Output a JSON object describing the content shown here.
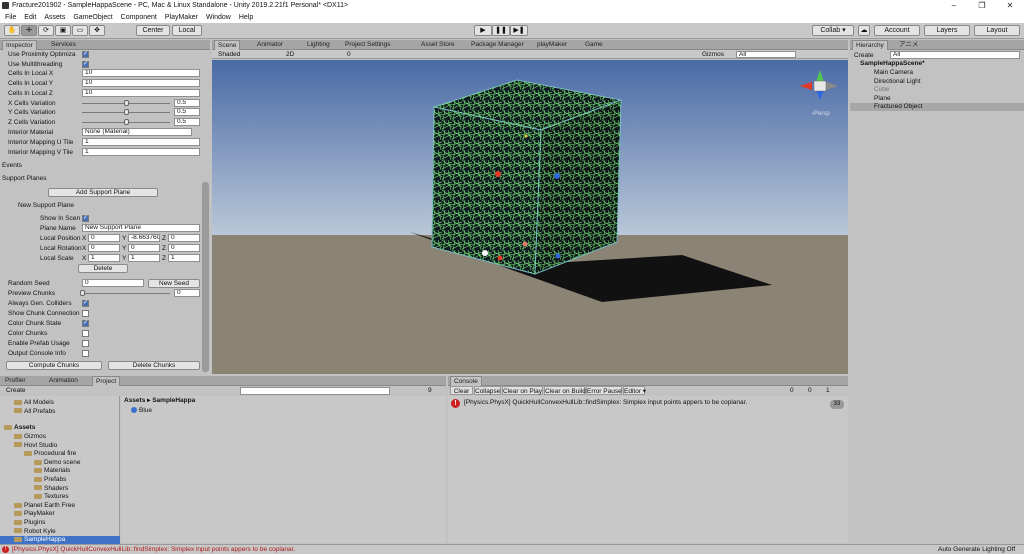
{
  "window": {
    "title": "Fracture201902 - SampleHappaScene - PC, Mac & Linux Standalone - Unity 2019.2.21f1 Personal* <DX11>",
    "minimize": "–",
    "maximize": "❐",
    "close": "✕"
  },
  "menu": [
    "File",
    "Edit",
    "Assets",
    "GameObject",
    "Component",
    "PlayMaker",
    "Window",
    "Help"
  ],
  "toolbar": {
    "center": "Center",
    "local": "Local",
    "collab": "Collab ▾",
    "account": "Account",
    "layers": "Layers",
    "layout": "Layout",
    "play": "▶",
    "pause": "❚❚",
    "step": "▶❚",
    "tools": [
      "✋",
      "✛",
      "⟳",
      "▣",
      "▭",
      "✥"
    ]
  },
  "inspector": {
    "tabs": [
      "Inspector",
      "Services"
    ],
    "rows": [
      {
        "label": "Use Proximity Optimiza",
        "type": "check",
        "on": true
      },
      {
        "label": "Use Multithreading",
        "type": "check",
        "on": true
      },
      {
        "label": "Cells In Local X",
        "type": "field",
        "value": "10"
      },
      {
        "label": "Cells In Local Y",
        "type": "field",
        "value": "10"
      },
      {
        "label": "Cells In Local Z",
        "type": "field",
        "value": "10"
      },
      {
        "label": "X Cells Variation",
        "type": "slider",
        "value": "0.5",
        "level": 0.5
      },
      {
        "label": "Y Cells Variation",
        "type": "slider",
        "value": "0.5",
        "level": 0.5
      },
      {
        "label": "Z Cells Variation",
        "type": "slider",
        "value": "0.5",
        "level": 0.5
      }
    ],
    "interior_material": {
      "label": "Interior Material",
      "value": "None (Material)"
    },
    "mapping_u": {
      "label": "Interior Mapping U Tile",
      "value": "1"
    },
    "mapping_v": {
      "label": "Interior Mapping V Tile",
      "value": "1"
    },
    "events": "Events",
    "support_planes": "Support Planes",
    "add_support_plane": "Add Support Plane",
    "new_support_plane": "New Support Plane",
    "show_in_scene": "Show In Scen",
    "plane_name_label": "Plane Name",
    "plane_name_value": "New Support Plane",
    "local_position": {
      "label": "Local Position",
      "x": "0",
      "y": "-8.663760",
      "z": "0"
    },
    "local_rotation": {
      "label": "Local Rotation",
      "x": "0",
      "y": "0",
      "z": "0"
    },
    "local_scale": {
      "label": "Local Scale",
      "x": "1",
      "y": "1",
      "z": "1"
    },
    "delete": "Delete",
    "random_seed": {
      "label": "Random Seed",
      "value": "0",
      "button": "New Seed"
    },
    "preview_chunks": {
      "label": "Preview Chunks",
      "value": "0",
      "level": 0
    },
    "toggles": [
      {
        "label": "Always Gen. Colliders",
        "on": true
      },
      {
        "label": "Show Chunk Connection",
        "on": false
      },
      {
        "label": "Color Chunk State",
        "on": true
      },
      {
        "label": "Color Chunks",
        "on": false
      },
      {
        "label": "Enable Prefab Usage",
        "on": false
      },
      {
        "label": "Output Console Info",
        "on": false
      }
    ],
    "compute": "Compute Chunks",
    "delete_chunks": "Delete Chunks"
  },
  "scene": {
    "tabs": [
      "Scene",
      "Animator",
      "Lighting",
      "Project Settings",
      "Asset Store",
      "Package Manager",
      "playMaker",
      "Game"
    ],
    "shading": "Shaded",
    "mode2d": "2D",
    "gizmos": "Gizmos",
    "search_placeholder": "All",
    "persp": "‹Persp",
    "counter": "0"
  },
  "hierarchy": {
    "tab": "Hierarchy",
    "tab2": "アニメ",
    "create": "Create",
    "search_placeholder": "All",
    "scene": "SampleHappaScene*",
    "items": [
      "Main Camera",
      "Directional Light",
      "Cube",
      "Plane",
      "Fractured Object"
    ]
  },
  "project": {
    "tabs": [
      "Profiler",
      "Animation",
      "Project"
    ],
    "create": "Create",
    "favorites": [
      "All Models",
      "All Prefabs"
    ],
    "assets_root": "Assets",
    "tree": [
      {
        "name": "Gizmos",
        "depth": 1
      },
      {
        "name": "Hovl Studio",
        "depth": 1
      },
      {
        "name": "Procedural fire",
        "depth": 2
      },
      {
        "name": "Demo scene",
        "depth": 3
      },
      {
        "name": "Materials",
        "depth": 3
      },
      {
        "name": "Prefabs",
        "depth": 3
      },
      {
        "name": "Shaders",
        "depth": 3
      },
      {
        "name": "Textures",
        "depth": 3
      },
      {
        "name": "Planet Earth Free",
        "depth": 1
      },
      {
        "name": "PlayMaker",
        "depth": 1
      },
      {
        "name": "Plugins",
        "depth": 1
      },
      {
        "name": "Robot Kyle",
        "depth": 1
      },
      {
        "name": "SampleHappa",
        "depth": 1
      }
    ],
    "breadcrumb_root": "Assets",
    "breadcrumb_sep": "▸",
    "breadcrumb_leaf": "SampleHappa",
    "files": [
      "Blue"
    ],
    "count": "9"
  },
  "console": {
    "tab": "Console",
    "buttons": [
      "Clear",
      "Collapse",
      "Clear on Play",
      "Clear on Build",
      "Error Pause",
      "Editor ▾"
    ],
    "counts": [
      "0",
      "0",
      "1"
    ],
    "message": "[Physics.PhysX] QuickHullConvexHullLib::findSimplex: Simplex input points appers to be coplanar.",
    "badge": "33"
  },
  "status": {
    "message": "[Physics.PhysX] QuickHullConvexHullLib::findSimplex: Simplex input points appers to be coplanar.",
    "right": "Auto Generate Lighting Off"
  },
  "colors": {
    "error": "#cc1f1f",
    "selection": "#3f72c4",
    "mesh": "#69d36a",
    "sky_top": "#4d6ea8",
    "ground": "#8d8677"
  }
}
